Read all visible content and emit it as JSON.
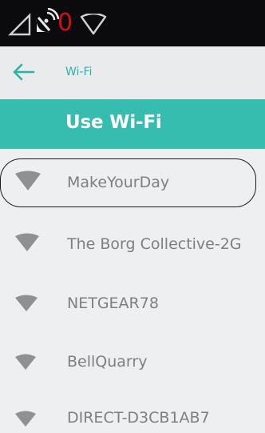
{
  "status_bar": {
    "notification_count": "0",
    "icons": [
      "signal-outline-icon",
      "satellite-dish-icon",
      "wifi-outline-icon"
    ],
    "count_color": "#d40f14"
  },
  "app_bar": {
    "back_icon": "arrow-left-icon",
    "title": "Wi-Fi",
    "accent_color": "#2bb3a6"
  },
  "toggle": {
    "label": "Use Wi-Fi",
    "background_color": "#37bdb0"
  },
  "networks": [
    {
      "name": "MakeYourDay",
      "icon": "wifi-signal-icon",
      "highlighted": true
    },
    {
      "name": "The Borg Collective-2G",
      "icon": "wifi-signal-icon",
      "highlighted": false
    },
    {
      "name": "NETGEAR78",
      "icon": "wifi-signal-icon",
      "highlighted": false
    },
    {
      "name": "BellQuarry",
      "icon": "wifi-signal-icon",
      "highlighted": false
    },
    {
      "name": "DIRECT-D3CB1AB7",
      "icon": "wifi-signal-icon",
      "highlighted": false
    }
  ]
}
